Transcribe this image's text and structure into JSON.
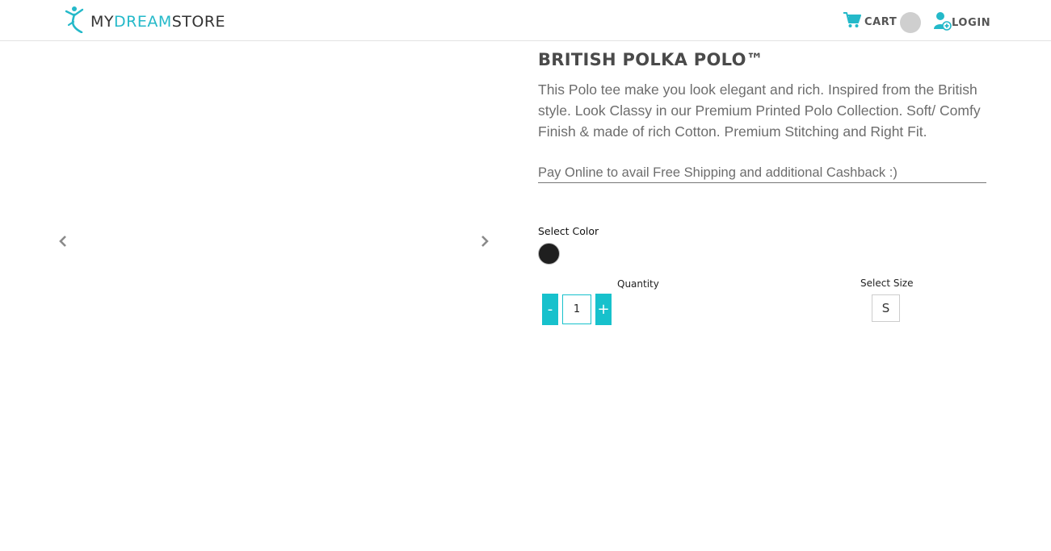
{
  "header": {
    "logo": {
      "my": "MY",
      "dream": "DREAM",
      "store": "STORE"
    },
    "cart_label": "CART",
    "login_label": "LOGIN"
  },
  "product": {
    "title": "BRITISH POLKA POLO™",
    "description": "This Polo tee make you look elegant and rich. Inspired from the British style.  Look Classy in our Premium Printed Polo Collection. Soft/ Comfy Finish & made of rich Cotton. Premium Stitching and Right Fit.",
    "shipping_note": "Pay Online to avail Free Shipping and additional Cashback :)",
    "color_label": "Select Color",
    "quantity_label": "Quantity",
    "quantity_value": "1",
    "minus_label": "-",
    "plus_label": "+",
    "size_label": "Select Size",
    "size_option": "S"
  },
  "colors": {
    "accent": "#17c1cc",
    "swatch": "#1f1f1f",
    "cart_badge": "#cfcfcf"
  },
  "icons": {
    "logo": "dancer-logo-icon",
    "cart": "shopping-cart-icon",
    "login": "user-add-icon",
    "prev": "chevron-left-icon",
    "next": "chevron-right-icon"
  }
}
